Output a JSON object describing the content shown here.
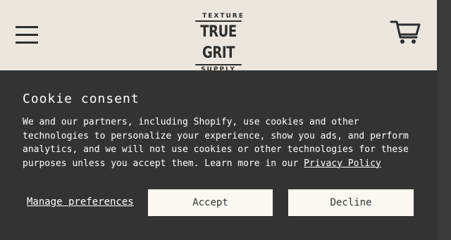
{
  "header": {
    "logo": {
      "top": "TEXTURE",
      "main": "TRUE GRIT",
      "bottom": "SUPPLY"
    },
    "menu_icon": "hamburger-menu-icon",
    "cart_icon": "shopping-cart-icon"
  },
  "cookie": {
    "title": "Cookie consent",
    "body": "We and our partners, including Shopify, use cookies and other technologies to personalize your experience, show you ads, and perform analytics, and we will not use cookies or other technologies for these purposes unless you accept them. Learn more in our ",
    "privacy_link": "Privacy Policy",
    "manage_label": "Manage preferences",
    "accept_label": "Accept",
    "decline_label": "Decline"
  },
  "colors": {
    "header_bg": "#ece6df",
    "banner_bg": "#333333",
    "button_bg": "#fbf8f2",
    "text_dark": "#2d2d2d"
  }
}
